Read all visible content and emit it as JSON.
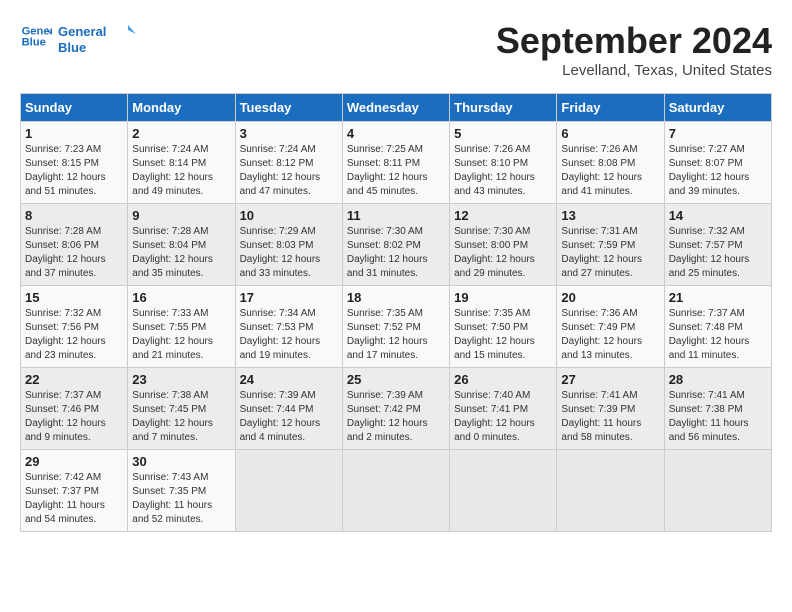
{
  "header": {
    "logo_general": "General",
    "logo_blue": "Blue",
    "month_year": "September 2024",
    "location": "Levelland, Texas, United States"
  },
  "days_of_week": [
    "Sunday",
    "Monday",
    "Tuesday",
    "Wednesday",
    "Thursday",
    "Friday",
    "Saturday"
  ],
  "weeks": [
    [
      {
        "day": "1",
        "sunrise": "Sunrise: 7:23 AM",
        "sunset": "Sunset: 8:15 PM",
        "daylight": "Daylight: 12 hours and 51 minutes."
      },
      {
        "day": "2",
        "sunrise": "Sunrise: 7:24 AM",
        "sunset": "Sunset: 8:14 PM",
        "daylight": "Daylight: 12 hours and 49 minutes."
      },
      {
        "day": "3",
        "sunrise": "Sunrise: 7:24 AM",
        "sunset": "Sunset: 8:12 PM",
        "daylight": "Daylight: 12 hours and 47 minutes."
      },
      {
        "day": "4",
        "sunrise": "Sunrise: 7:25 AM",
        "sunset": "Sunset: 8:11 PM",
        "daylight": "Daylight: 12 hours and 45 minutes."
      },
      {
        "day": "5",
        "sunrise": "Sunrise: 7:26 AM",
        "sunset": "Sunset: 8:10 PM",
        "daylight": "Daylight: 12 hours and 43 minutes."
      },
      {
        "day": "6",
        "sunrise": "Sunrise: 7:26 AM",
        "sunset": "Sunset: 8:08 PM",
        "daylight": "Daylight: 12 hours and 41 minutes."
      },
      {
        "day": "7",
        "sunrise": "Sunrise: 7:27 AM",
        "sunset": "Sunset: 8:07 PM",
        "daylight": "Daylight: 12 hours and 39 minutes."
      }
    ],
    [
      {
        "day": "8",
        "sunrise": "Sunrise: 7:28 AM",
        "sunset": "Sunset: 8:06 PM",
        "daylight": "Daylight: 12 hours and 37 minutes."
      },
      {
        "day": "9",
        "sunrise": "Sunrise: 7:28 AM",
        "sunset": "Sunset: 8:04 PM",
        "daylight": "Daylight: 12 hours and 35 minutes."
      },
      {
        "day": "10",
        "sunrise": "Sunrise: 7:29 AM",
        "sunset": "Sunset: 8:03 PM",
        "daylight": "Daylight: 12 hours and 33 minutes."
      },
      {
        "day": "11",
        "sunrise": "Sunrise: 7:30 AM",
        "sunset": "Sunset: 8:02 PM",
        "daylight": "Daylight: 12 hours and 31 minutes."
      },
      {
        "day": "12",
        "sunrise": "Sunrise: 7:30 AM",
        "sunset": "Sunset: 8:00 PM",
        "daylight": "Daylight: 12 hours and 29 minutes."
      },
      {
        "day": "13",
        "sunrise": "Sunrise: 7:31 AM",
        "sunset": "Sunset: 7:59 PM",
        "daylight": "Daylight: 12 hours and 27 minutes."
      },
      {
        "day": "14",
        "sunrise": "Sunrise: 7:32 AM",
        "sunset": "Sunset: 7:57 PM",
        "daylight": "Daylight: 12 hours and 25 minutes."
      }
    ],
    [
      {
        "day": "15",
        "sunrise": "Sunrise: 7:32 AM",
        "sunset": "Sunset: 7:56 PM",
        "daylight": "Daylight: 12 hours and 23 minutes."
      },
      {
        "day": "16",
        "sunrise": "Sunrise: 7:33 AM",
        "sunset": "Sunset: 7:55 PM",
        "daylight": "Daylight: 12 hours and 21 minutes."
      },
      {
        "day": "17",
        "sunrise": "Sunrise: 7:34 AM",
        "sunset": "Sunset: 7:53 PM",
        "daylight": "Daylight: 12 hours and 19 minutes."
      },
      {
        "day": "18",
        "sunrise": "Sunrise: 7:35 AM",
        "sunset": "Sunset: 7:52 PM",
        "daylight": "Daylight: 12 hours and 17 minutes."
      },
      {
        "day": "19",
        "sunrise": "Sunrise: 7:35 AM",
        "sunset": "Sunset: 7:50 PM",
        "daylight": "Daylight: 12 hours and 15 minutes."
      },
      {
        "day": "20",
        "sunrise": "Sunrise: 7:36 AM",
        "sunset": "Sunset: 7:49 PM",
        "daylight": "Daylight: 12 hours and 13 minutes."
      },
      {
        "day": "21",
        "sunrise": "Sunrise: 7:37 AM",
        "sunset": "Sunset: 7:48 PM",
        "daylight": "Daylight: 12 hours and 11 minutes."
      }
    ],
    [
      {
        "day": "22",
        "sunrise": "Sunrise: 7:37 AM",
        "sunset": "Sunset: 7:46 PM",
        "daylight": "Daylight: 12 hours and 9 minutes."
      },
      {
        "day": "23",
        "sunrise": "Sunrise: 7:38 AM",
        "sunset": "Sunset: 7:45 PM",
        "daylight": "Daylight: 12 hours and 7 minutes."
      },
      {
        "day": "24",
        "sunrise": "Sunrise: 7:39 AM",
        "sunset": "Sunset: 7:44 PM",
        "daylight": "Daylight: 12 hours and 4 minutes."
      },
      {
        "day": "25",
        "sunrise": "Sunrise: 7:39 AM",
        "sunset": "Sunset: 7:42 PM",
        "daylight": "Daylight: 12 hours and 2 minutes."
      },
      {
        "day": "26",
        "sunrise": "Sunrise: 7:40 AM",
        "sunset": "Sunset: 7:41 PM",
        "daylight": "Daylight: 12 hours and 0 minutes."
      },
      {
        "day": "27",
        "sunrise": "Sunrise: 7:41 AM",
        "sunset": "Sunset: 7:39 PM",
        "daylight": "Daylight: 11 hours and 58 minutes."
      },
      {
        "day": "28",
        "sunrise": "Sunrise: 7:41 AM",
        "sunset": "Sunset: 7:38 PM",
        "daylight": "Daylight: 11 hours and 56 minutes."
      }
    ],
    [
      {
        "day": "29",
        "sunrise": "Sunrise: 7:42 AM",
        "sunset": "Sunset: 7:37 PM",
        "daylight": "Daylight: 11 hours and 54 minutes."
      },
      {
        "day": "30",
        "sunrise": "Sunrise: 7:43 AM",
        "sunset": "Sunset: 7:35 PM",
        "daylight": "Daylight: 11 hours and 52 minutes."
      },
      {
        "day": "",
        "sunrise": "",
        "sunset": "",
        "daylight": ""
      },
      {
        "day": "",
        "sunrise": "",
        "sunset": "",
        "daylight": ""
      },
      {
        "day": "",
        "sunrise": "",
        "sunset": "",
        "daylight": ""
      },
      {
        "day": "",
        "sunrise": "",
        "sunset": "",
        "daylight": ""
      },
      {
        "day": "",
        "sunrise": "",
        "sunset": "",
        "daylight": ""
      }
    ]
  ]
}
